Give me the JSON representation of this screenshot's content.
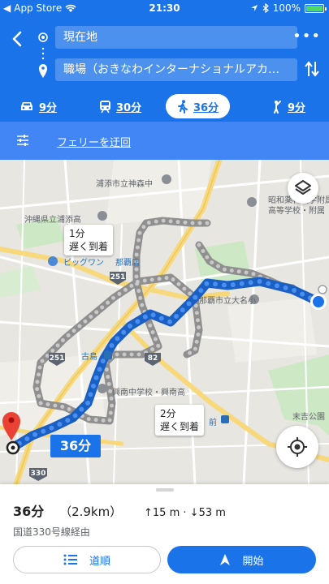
{
  "status_bar": {
    "carrier": "App Store",
    "time": "21:30",
    "battery": "100%"
  },
  "header": {
    "origin": "現在地",
    "destination": "職場（おきなわインターナショナルアカ…",
    "more_label": "•••"
  },
  "modes": [
    {
      "name": "car",
      "time": "9分"
    },
    {
      "name": "transit",
      "time": "30分"
    },
    {
      "name": "walk",
      "time": "36分",
      "active": true
    },
    {
      "name": "ride-share",
      "time": "9分"
    }
  ],
  "options": {
    "link": "フェリーを迂回"
  },
  "map": {
    "labels": [
      "浦添市立神森中",
      "沖縄県立浦添高",
      "昭和薬科大学附属",
      "高等学校・附属",
      "ビッグワン",
      "那覇店",
      "那覇市立大名小",
      "古島",
      "興南中学校・興南高",
      "末吉公園",
      "前"
    ],
    "route_shields": [
      "251",
      "251",
      "82",
      "330"
    ],
    "callouts": [
      {
        "time": "1分",
        "note": "遅く到着"
      },
      {
        "time": "2分",
        "note": "遅く到着"
      }
    ],
    "selected_time": "36分"
  },
  "sheet": {
    "duration": "36分",
    "distance": "（2.9km）",
    "ascent": "15 m",
    "descent": "53 m",
    "via": "国道330号線経由",
    "steps_label": "道順",
    "start_label": "開始"
  },
  "colors": {
    "primary": "#1a73e8",
    "options_bar": "#4285f4",
    "route_alt": "#9e9e9e",
    "pin": "#ea4335"
  }
}
